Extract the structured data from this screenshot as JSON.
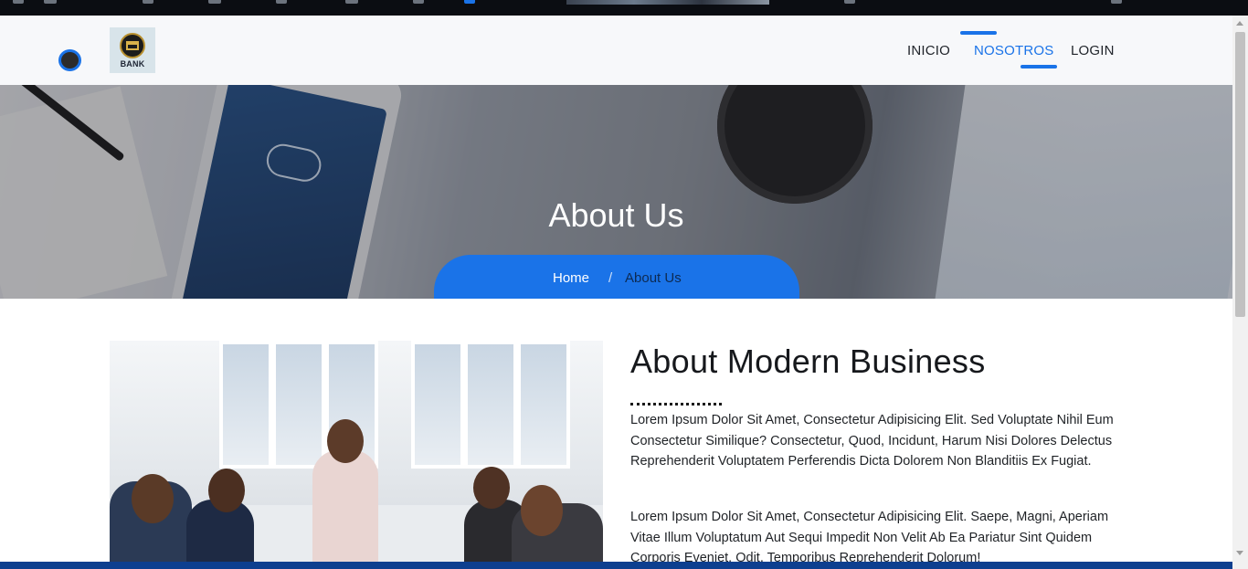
{
  "nav": {
    "logo_text": "BANK",
    "links": [
      {
        "label": "INICIO",
        "active": false
      },
      {
        "label": "NOSOTROS",
        "active": true
      },
      {
        "label": "LOGIN",
        "active": false
      }
    ],
    "accent_color": "#1a73e8"
  },
  "hero": {
    "title": "About Us",
    "breadcrumb": {
      "home": "Home",
      "separator": "/",
      "current": "About Us"
    }
  },
  "about": {
    "heading": "About Modern Business",
    "paragraphs": [
      "Lorem Ipsum Dolor Sit Amet, Consectetur Adipisicing Elit. Sed Voluptate Nihil Eum Consectetur Similique? Consectetur, Quod, Incidunt, Harum Nisi Dolores Delectus Reprehenderit Voluptatem Perferendis Dicta Dolorem Non Blanditiis Ex Fugiat.",
      "Lorem Ipsum Dolor Sit Amet, Consectetur Adipisicing Elit. Saepe, Magni, Aperiam Vitae Illum Voluptatum Aut Sequi Impedit Non Velit Ab Ea Pariatur Sint Quidem Corporis Eveniet. Odit, Temporibus Reprehenderit Dolorum!"
    ]
  }
}
